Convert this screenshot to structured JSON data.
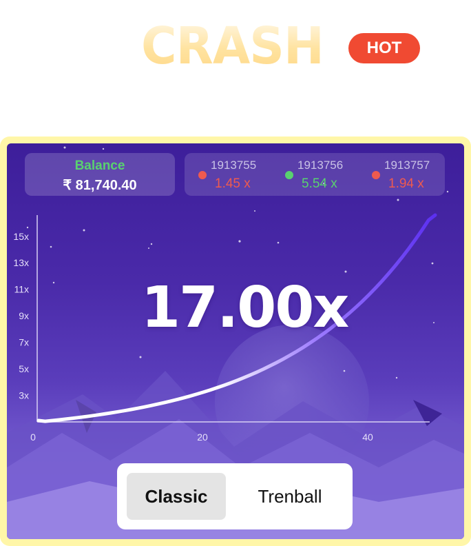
{
  "header": {
    "title": "CRASH",
    "badge": "HOT",
    "title_color": "#ffe3a0",
    "badge_color": "#f04a32"
  },
  "balance": {
    "label": "Balance",
    "value": "₹ 81,740.40",
    "label_color": "#59d26f"
  },
  "history": [
    {
      "round": "1913755",
      "multiplier": "1.45 x",
      "status": "lost",
      "color": "#ef5a4f"
    },
    {
      "round": "1913756",
      "multiplier": "5.54 x",
      "status": "won",
      "color": "#59d26f"
    },
    {
      "round": "1913757",
      "multiplier": "1.94 x",
      "status": "lost",
      "color": "#ef5a4f"
    }
  ],
  "current_multiplier": "17.00x",
  "chart_data": {
    "type": "line",
    "y_tick_labels": [
      "15x",
      "13x",
      "11x",
      "9x",
      "7x",
      "5x",
      "3x"
    ],
    "y_ticks": [
      15,
      13,
      11,
      9,
      7,
      5,
      3
    ],
    "x_tick_labels": [
      "0",
      "20",
      "40"
    ],
    "x_ticks": [
      0,
      20,
      40
    ],
    "ylim": [
      1,
      16.6
    ],
    "xlim": [
      0,
      48
    ],
    "curve": {
      "x_end": 48,
      "y_end": 17.0,
      "growth": "exponential"
    },
    "colors": {
      "start": "#ffffff",
      "end": "#6a35f0"
    }
  },
  "modes": {
    "options": [
      "Classic",
      "Trenball"
    ],
    "selected": "Classic"
  }
}
